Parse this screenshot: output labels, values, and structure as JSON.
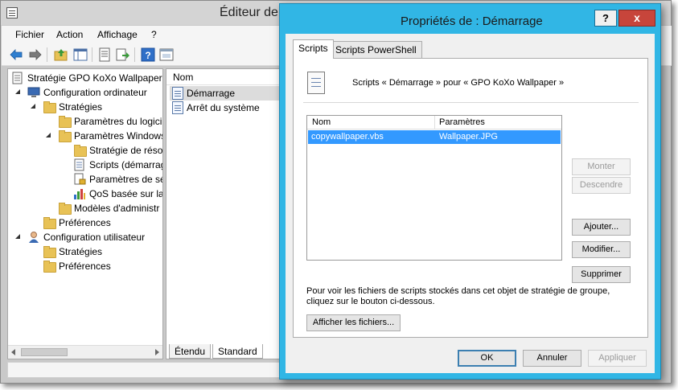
{
  "main_window": {
    "title": "Éditeur de g",
    "menu": [
      "Fichier",
      "Action",
      "Affichage",
      "?"
    ],
    "toolbar_icons": [
      "back-arrow-icon",
      "forward-arrow-icon",
      "up-folder-icon",
      "show-hide-tree-icon",
      "properties-icon",
      "export-icon",
      "help-icon",
      "console-icon"
    ],
    "tree": [
      {
        "label": "Stratégie GPO KoXo Wallpaper [",
        "icon": "policy-document-icon",
        "depth": 0,
        "arrow": "none"
      },
      {
        "label": "Configuration ordinateur",
        "icon": "computer-icon",
        "depth": 1,
        "arrow": "expanded"
      },
      {
        "label": "Stratégies",
        "icon": "folder-icon",
        "depth": 2,
        "arrow": "expanded"
      },
      {
        "label": "Paramètres du logici",
        "icon": "folder-icon",
        "depth": 3,
        "arrow": "collapsed"
      },
      {
        "label": "Paramètres Windows",
        "icon": "folder-icon",
        "depth": 3,
        "arrow": "expanded"
      },
      {
        "label": "Stratégie de résol",
        "icon": "folder-icon",
        "depth": 4,
        "arrow": "collapsed"
      },
      {
        "label": "Scripts (démarrag",
        "icon": "script-icon",
        "depth": 4,
        "arrow": "none"
      },
      {
        "label": "Paramètres de sé",
        "icon": "security-settings-icon",
        "depth": 4,
        "arrow": "collapsed"
      },
      {
        "label": "QoS basée sur la",
        "icon": "bar-chart-icon",
        "depth": 4,
        "arrow": "collapsed"
      },
      {
        "label": "Modèles d'administr",
        "icon": "folder-icon",
        "depth": 3,
        "arrow": "collapsed"
      },
      {
        "label": "Préférences",
        "icon": "folder-icon",
        "depth": 2,
        "arrow": "collapsed"
      },
      {
        "label": "Configuration utilisateur",
        "icon": "user-icon",
        "depth": 1,
        "arrow": "expanded"
      },
      {
        "label": "Stratégies",
        "icon": "folder-icon",
        "depth": 2,
        "arrow": "collapsed"
      },
      {
        "label": "Préférences",
        "icon": "folder-icon",
        "depth": 2,
        "arrow": "collapsed"
      }
    ],
    "list": {
      "column_header": "Nom",
      "items": [
        "Démarrage",
        "Arrêt du système"
      ]
    },
    "bottom_tabs": [
      "Étendu",
      "Standard"
    ]
  },
  "dialog": {
    "title": "Propriétés de : Démarrage",
    "help_button": "?",
    "close_button": "x",
    "tabs": [
      "Scripts",
      "Scripts PowerShell"
    ],
    "heading": "Scripts « Démarrage » pour « GPO KoXo Wallpaper »",
    "scripts_table": {
      "columns": [
        "Nom",
        "Paramètres"
      ],
      "rows": [
        {
          "name": "copywallpaper.vbs",
          "params": "Wallpaper.JPG"
        }
      ]
    },
    "side_buttons": {
      "up": "Monter",
      "down": "Descendre",
      "add": "Ajouter...",
      "edit": "Modifier...",
      "delete": "Supprimer"
    },
    "info_text": "Pour voir les fichiers de scripts stockés dans cet objet de stratégie de groupe, cliquez sur le bouton ci-dessous.",
    "show_files_button": "Afficher les fichiers...",
    "footer_buttons": {
      "ok": "OK",
      "cancel": "Annuler",
      "apply": "Appliquer"
    },
    "accent_color": "#31b6e5"
  }
}
